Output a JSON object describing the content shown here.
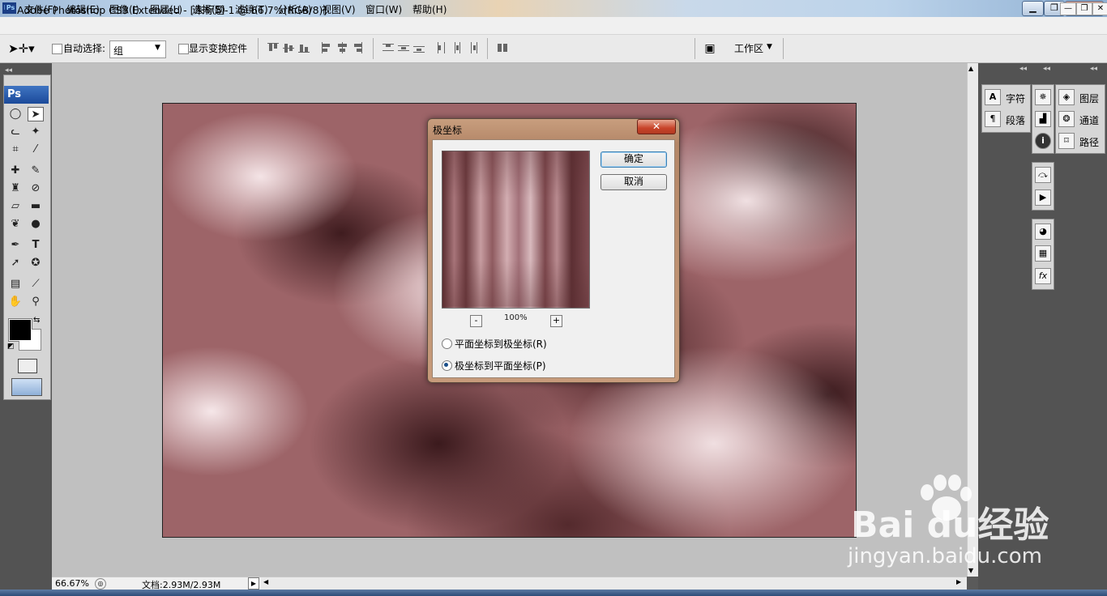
{
  "window": {
    "title": "Adobe Photoshop CS3 Extended - [未标题-1 @ 66.7%(RGB/8)]",
    "app_icon": "Ps",
    "controls": [
      "▁",
      "❐",
      "✕"
    ]
  },
  "menu": {
    "items": [
      "文件(F)",
      "编辑(E)",
      "图像(I)",
      "图层(L)",
      "选择(S)",
      "滤镜(T)",
      "分析(A)",
      "视图(V)",
      "窗口(W)",
      "帮助(H)"
    ],
    "doc_controls": [
      "—",
      "❐",
      "✕"
    ]
  },
  "options": {
    "auto_select_label": "自动选择:",
    "auto_select_value": "组",
    "show_transform_label": "显示变换控件",
    "workspace_label": "工作区"
  },
  "tools": {
    "header": "Ps"
  },
  "dialog": {
    "title": "极坐标",
    "close": "✕",
    "ok": "确定",
    "cancel": "取消",
    "zoom_minus": "-",
    "zoom_plus": "+",
    "zoom_level": "100%",
    "options": [
      {
        "label": "平面坐标到极坐标(R)",
        "selected": false
      },
      {
        "label": "极坐标到平面坐标(P)",
        "selected": true
      }
    ]
  },
  "status": {
    "zoom": "66.67%",
    "doc": "文档:2.93M/2.93M"
  },
  "panels": {
    "group1": [
      "字符",
      "段落"
    ],
    "group3": [
      "图层",
      "通道",
      "路径"
    ]
  },
  "watermark": {
    "brand": "Bai du经验",
    "url": "jingyan.baidu.com"
  },
  "colors": {
    "accent": "#1b4a9a",
    "canvas_base": "#9d6468"
  }
}
